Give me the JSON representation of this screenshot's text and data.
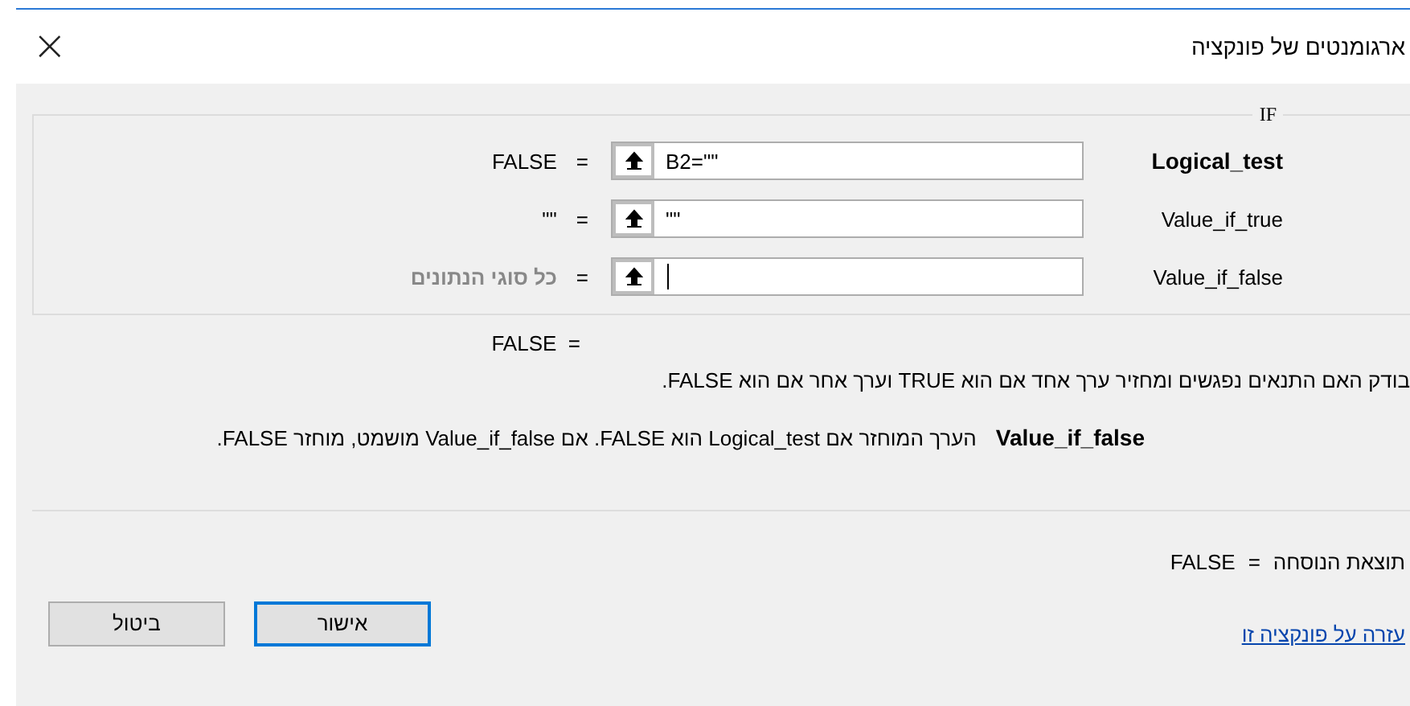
{
  "window": {
    "title": "ארגומנטים של פונקציה",
    "close": "×"
  },
  "function": {
    "name": "IF",
    "arguments": [
      {
        "label": "Logical_test",
        "required": true,
        "value": "B2=\"\"",
        "focused": false,
        "equals": "=",
        "result": "FALSE",
        "result_dimmed": false
      },
      {
        "label": "Value_if_true",
        "required": false,
        "value": "\"\"",
        "focused": false,
        "equals": "=",
        "result": "\"\"",
        "result_dimmed": false
      },
      {
        "label": "Value_if_false",
        "required": false,
        "focused": true,
        "equals": "=",
        "result": "כל סוגי הנתונים",
        "result_dimmed": true
      }
    ],
    "result_line": "FALSE  =",
    "description": "בודק האם התנאים נפגשים ומחזיר ערך אחד אם הוא TRUE וערך אחר אם הוא FALSE.",
    "argument_help": {
      "name": "Value_if_false",
      "text": "הערך המוחזר אם Logical_test הוא FALSE. אם Value_if_false מושמט, מוחזר FALSE."
    }
  },
  "formula_result": {
    "label": "תוצאת הנוסחה",
    "equals": "=",
    "value": "FALSE"
  },
  "help_link": "עזרה על פונקציה זו",
  "buttons": [
    {
      "label": "אישור",
      "default": true
    },
    {
      "label": "ביטול",
      "default": false
    }
  ]
}
